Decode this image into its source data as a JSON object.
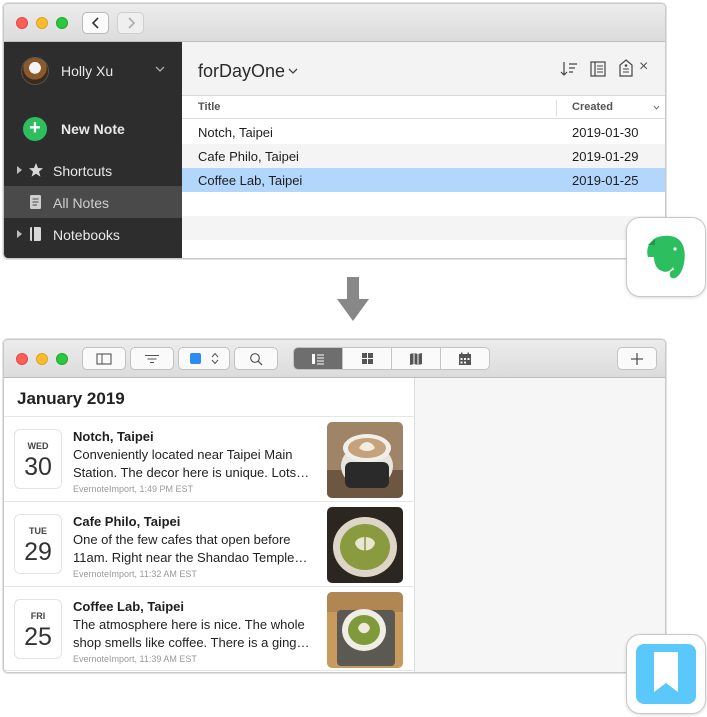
{
  "evernote": {
    "user": {
      "name": "Holly Xu"
    },
    "sidebar": {
      "new_note_label": "New Note",
      "items": [
        {
          "label": "Shortcuts",
          "icon": "star-icon",
          "active": false
        },
        {
          "label": "All Notes",
          "icon": "note-icon",
          "active": true
        },
        {
          "label": "Notebooks",
          "icon": "notebook-icon",
          "active": false
        }
      ]
    },
    "notebook_title": "forDayOne",
    "columns": {
      "title": "Title",
      "created": "Created"
    },
    "notes": [
      {
        "title": "Notch, Taipei",
        "created": "2019-01-30",
        "selected": false
      },
      {
        "title": "Cafe Philo, Taipei",
        "created": "2019-01-29",
        "selected": false
      },
      {
        "title": "Coffee Lab, Taipei",
        "created": "2019-01-25",
        "selected": true
      }
    ],
    "close_glyph": "×",
    "brand_color": "#2dbe60"
  },
  "arrow": {
    "icon": "down-arrow-icon"
  },
  "dayone": {
    "month_header": "January 2019",
    "brand_color": "#5ac8fa",
    "entries": [
      {
        "dow": "WED",
        "day": "30",
        "title": "Notch, Taipei",
        "body": "Conveniently located near Taipei Main Station. The decor here is unique. Lots…",
        "meta": "EvernoteImport,   1:49 PM EST"
      },
      {
        "dow": "TUE",
        "day": "29",
        "title": "Cafe Philo, Taipei",
        "body": "One of the few cafes that open before 11am. Right near the Shandao Temple…",
        "meta": "EvernoteImport,   11:32 AM EST"
      },
      {
        "dow": "FRI",
        "day": "25",
        "title": "Coffee Lab, Taipei",
        "body": "The atmosphere here is nice. The whole shop smells like coffee. There is a ging…",
        "meta": "EvernoteImport,   11:39 AM EST"
      }
    ]
  }
}
